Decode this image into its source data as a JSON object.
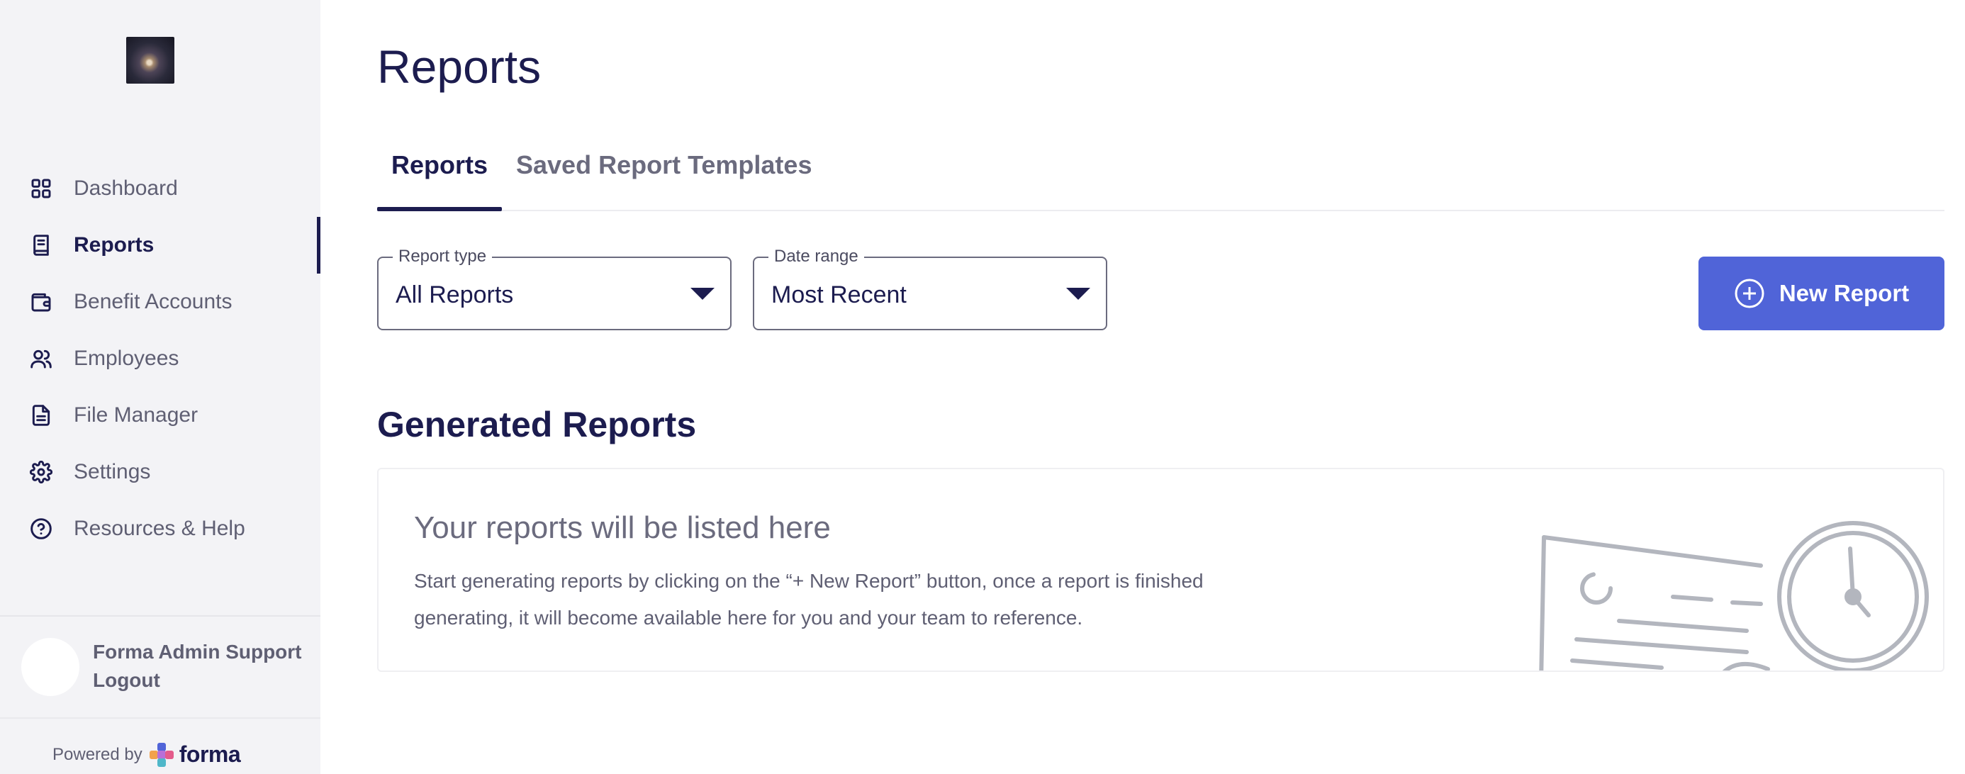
{
  "sidebar": {
    "nav": [
      {
        "label": "Dashboard",
        "icon": "grid-icon",
        "active": false
      },
      {
        "label": "Reports",
        "icon": "book-icon",
        "active": true
      },
      {
        "label": "Benefit Accounts",
        "icon": "wallet-icon",
        "active": false
      },
      {
        "label": "Employees",
        "icon": "users-icon",
        "active": false
      },
      {
        "label": "File Manager",
        "icon": "file-icon",
        "active": false
      },
      {
        "label": "Settings",
        "icon": "gear-icon",
        "active": false
      },
      {
        "label": "Resources & Help",
        "icon": "help-circle-icon",
        "active": false
      }
    ],
    "user": {
      "name": "Forma Admin Support",
      "logout": "Logout"
    },
    "powered_by": "Powered by",
    "brand": "forma"
  },
  "main": {
    "title": "Reports",
    "tabs": [
      {
        "label": "Reports",
        "active": true
      },
      {
        "label": "Saved Report Templates",
        "active": false
      }
    ],
    "filters": {
      "report_type": {
        "label": "Report type",
        "value": "All Reports"
      },
      "date_range": {
        "label": "Date range",
        "value": "Most Recent"
      }
    },
    "new_report_label": "New Report",
    "section_title": "Generated Reports",
    "empty_state": {
      "title": "Your reports will be listed here",
      "body": "Start generating reports by clicking on the “+ New Report” button, once a report is finished generating, it will become available here for you and your team to reference."
    }
  },
  "colors": {
    "navy": "#1c1c4f",
    "accent": "#5064d8",
    "sidebar_bg": "#f3f3f6",
    "muted_text": "#5f5f73"
  }
}
